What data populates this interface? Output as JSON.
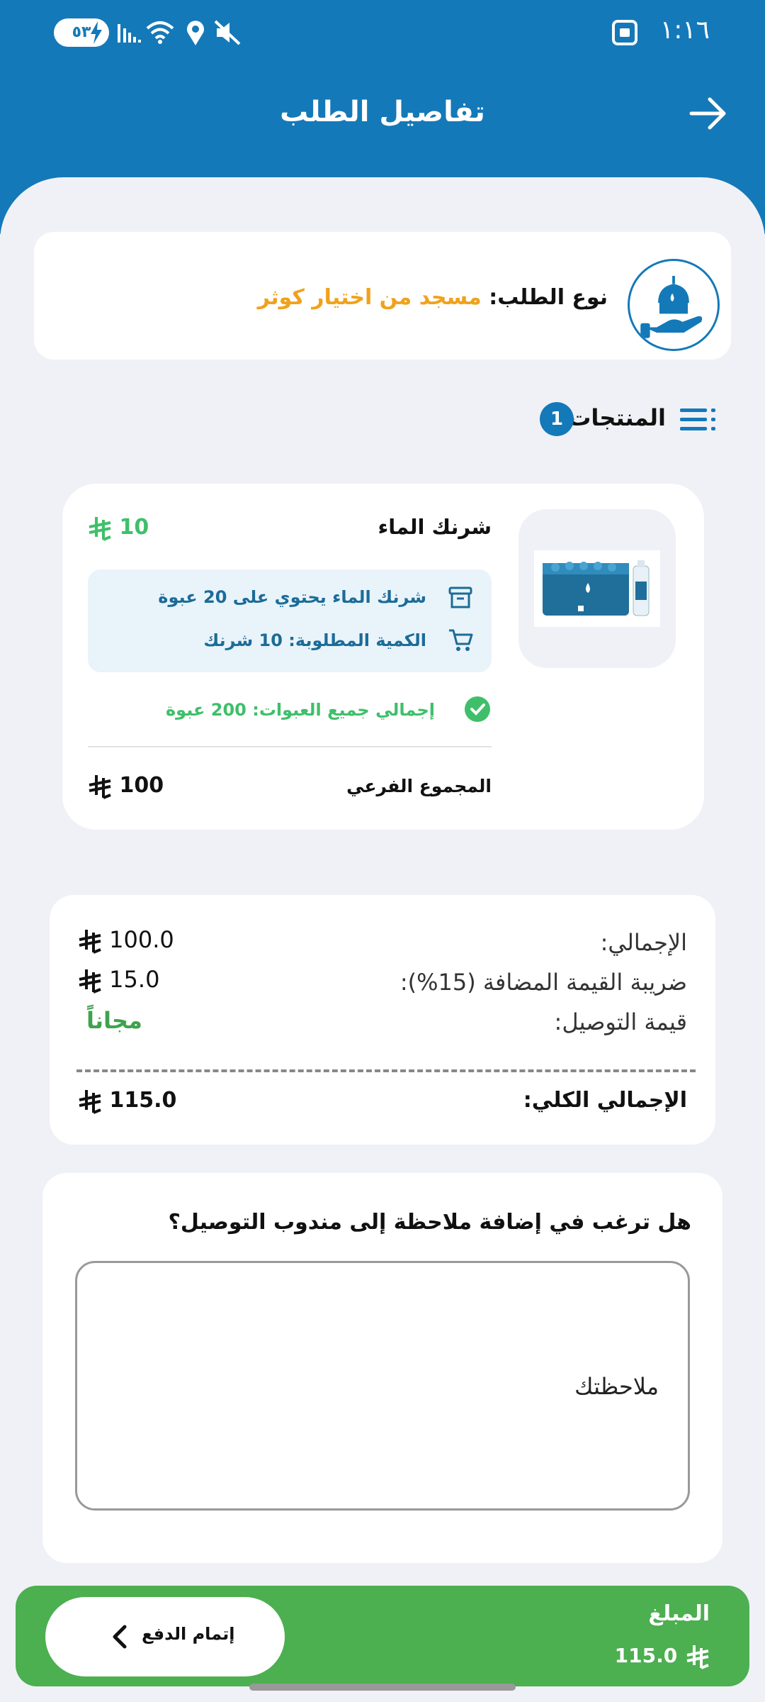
{
  "status_bar": {
    "time": "١:١٦",
    "battery": "٥٣",
    "icons": [
      "screenshot-icon",
      "signal-icon",
      "wifi-icon",
      "location-icon",
      "mute-icon",
      "charging-icon"
    ]
  },
  "header": {
    "title": "تفاصيل الطلب",
    "back_icon": "arrow-right-icon"
  },
  "order_type": {
    "label": "نوع الطلب:",
    "value": "مسجد من اختيار كوثر",
    "icon": "mosque-hand-icon"
  },
  "products_section": {
    "title": "المنتجات",
    "count": "1"
  },
  "product": {
    "name": "شرنك الماء",
    "price": "10",
    "info_contains": "شرنك الماء يحتوي على 20 عبوة",
    "info_quantity": "الكمية المطلوبة: 10 شرنك",
    "total_packs": "إجمالي جميع العبوات: 200 عبوة",
    "subtotal_label": "المجموع الفرعي",
    "subtotal_value": "100"
  },
  "summary": {
    "total_label": "الإجمالي:",
    "total_value": "100.0",
    "vat_label": "ضريبة القيمة المضافة (15%):",
    "vat_value": "15.0",
    "delivery_label": "قيمة التوصيل:",
    "delivery_value": "مجاناً",
    "grand_label": "الإجمالي الكلي:",
    "grand_value": "115.0"
  },
  "note": {
    "question": "هل ترغب في إضافة ملاحظة إلى مندوب التوصيل؟",
    "placeholder": "ملاحظتك",
    "value": ""
  },
  "payment_bar": {
    "amount_label": "المبلغ",
    "amount_value": "115.0",
    "button_label": "إتمام الدفع"
  },
  "colors": {
    "primary": "#1479b8",
    "accent_orange": "#f0a21c",
    "success_green": "#3fbf6a",
    "pay_bar": "#4caf50"
  }
}
